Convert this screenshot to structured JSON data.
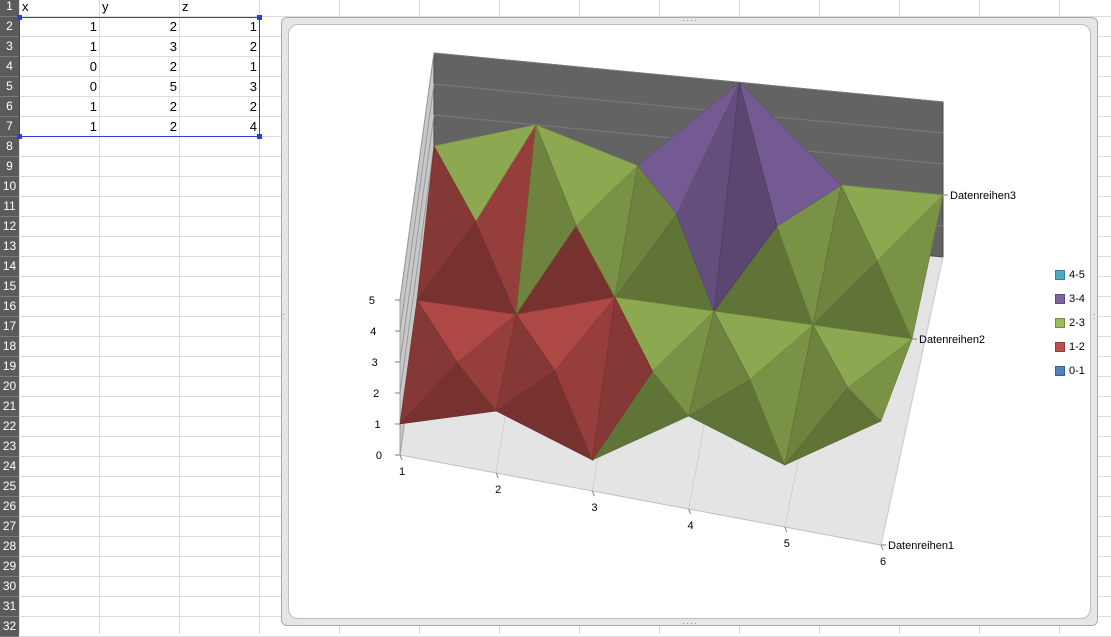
{
  "sheet": {
    "headers": [
      "x",
      "y",
      "z"
    ],
    "row_numbers": [
      "1",
      "2",
      "3",
      "4",
      "5",
      "6",
      "7",
      "8",
      "9",
      "10",
      "11",
      "12",
      "13",
      "14",
      "15",
      "16",
      "17",
      "18",
      "19",
      "20",
      "21",
      "22",
      "23",
      "24",
      "25",
      "26",
      "27",
      "28",
      "29",
      "30",
      "31",
      "32"
    ],
    "rows": [
      [
        "1",
        "2",
        "1"
      ],
      [
        "1",
        "3",
        "2"
      ],
      [
        "0",
        "2",
        "1"
      ],
      [
        "0",
        "5",
        "3"
      ],
      [
        "1",
        "2",
        "2"
      ],
      [
        "1",
        "2",
        "4"
      ]
    ]
  },
  "chart_data": {
    "type": "surface",
    "x_ticks": [
      "1",
      "2",
      "3",
      "4",
      "5",
      "6"
    ],
    "z_ticks": [
      "0",
      "1",
      "2",
      "3",
      "4",
      "5"
    ],
    "series": [
      {
        "name": "Datenreihen1",
        "values": [
          1,
          2,
          1,
          3,
          2,
          4
        ]
      },
      {
        "name": "Datenreihen2",
        "values": [
          1,
          1,
          2,
          2,
          2,
          2
        ]
      },
      {
        "name": "Datenreihen3",
        "values": [
          2,
          3,
          2,
          5,
          2,
          2
        ]
      }
    ],
    "zlim": [
      0,
      5
    ],
    "legend": [
      {
        "label": "4-5",
        "color": "#4bacc6"
      },
      {
        "label": "3-4",
        "color": "#8064a2"
      },
      {
        "label": "2-3",
        "color": "#9bbb59"
      },
      {
        "label": "1-2",
        "color": "#c0504d"
      },
      {
        "label": "0-1",
        "color": "#4f81bd"
      }
    ],
    "legend_position": "right",
    "walls": {
      "back": "#636363",
      "side": "#c8c8c8",
      "floor": "#e4e4e4"
    }
  }
}
